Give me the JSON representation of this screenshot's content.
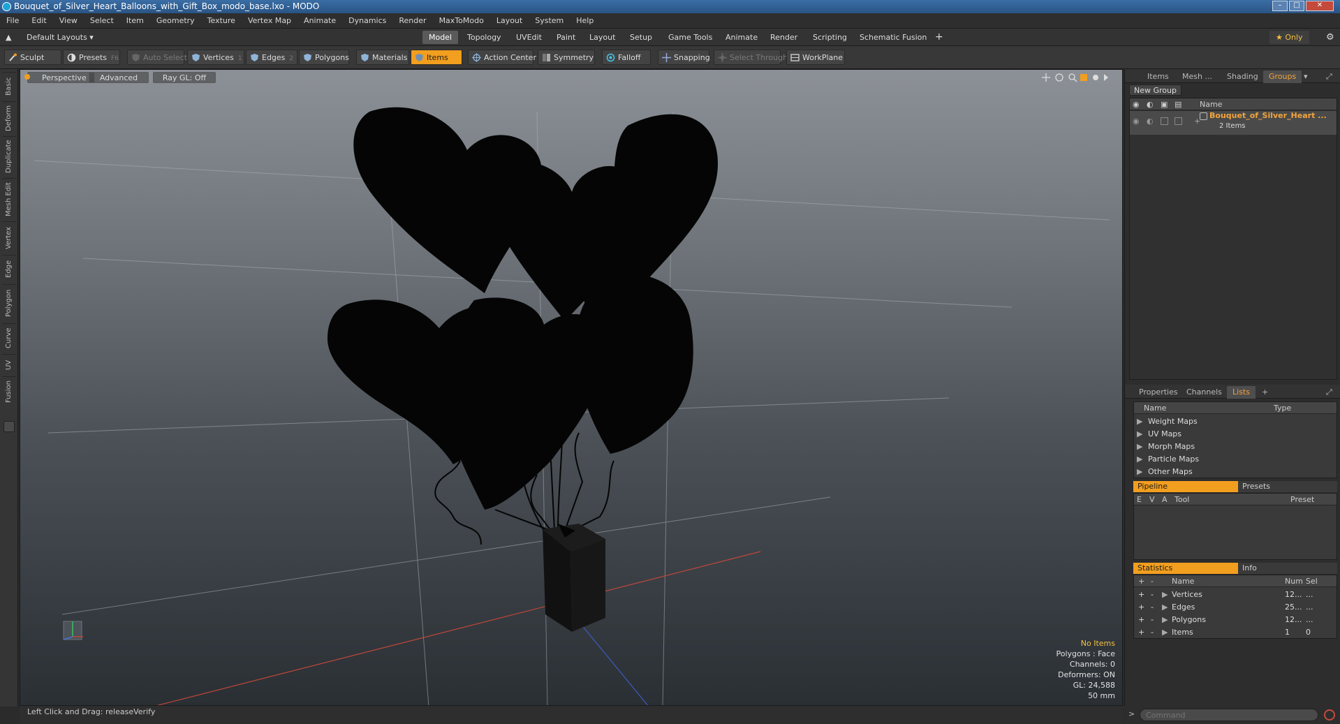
{
  "window": {
    "title": "Bouquet_of_Silver_Heart_Balloons_with_Gift_Box_modo_base.lxo - MODO"
  },
  "menu": [
    "File",
    "Edit",
    "View",
    "Select",
    "Item",
    "Geometry",
    "Texture",
    "Vertex Map",
    "Animate",
    "Dynamics",
    "Render",
    "MaxToModo",
    "Layout",
    "System",
    "Help"
  ],
  "layout": {
    "preset": "Default Layouts ▾",
    "tabs": [
      "Model",
      "Topology",
      "UVEdit",
      "Paint",
      "Layout",
      "Setup",
      "Game Tools",
      "Animate",
      "Render",
      "Scripting",
      "Schematic Fusion"
    ],
    "active_tab": "Model",
    "add": "+",
    "only": "★  Only",
    "settings": "⚙"
  },
  "toolbar": {
    "sculpt": "Sculpt",
    "presets": "Presets",
    "presets_key": "F6",
    "auto_select": "Auto Select",
    "vertices": "Vertices",
    "vertices_count": "1",
    "edges": "Edges",
    "edges_count": "2",
    "polygons": "Polygons",
    "materials": "Materials",
    "items": "Items",
    "action_center": "Action Center",
    "symmetry": "Symmetry",
    "falloff": "Falloff",
    "snapping": "Snapping",
    "select_through": "Select Through",
    "workplane": "WorkPlane"
  },
  "left_tabs": [
    "Basic",
    "Deform",
    "Duplicate",
    "Mesh Edit",
    "Vertex",
    "Edge",
    "Polygon",
    "Curve",
    "UV",
    "Fusion"
  ],
  "viewport": {
    "perspective": "Perspective",
    "advanced": "Advanced",
    "raygl": "Ray GL: Off",
    "info": {
      "no_items": "No Items",
      "polygons": "Polygons : Face",
      "channels": "Channels: 0",
      "deformers": "Deformers: ON",
      "gl": "GL: 24,588",
      "focal": "50 mm"
    }
  },
  "status": {
    "text": "Left Click and Drag:  releaseVerify"
  },
  "groups_panel": {
    "tabs": [
      "Items",
      "Mesh ...",
      "Shading",
      "Groups"
    ],
    "active_tab": "Groups",
    "new_group": "New Group",
    "col_name": "Name",
    "group_name": "Bouquet_of_Silver_Heart ...",
    "group_count": "2 Items"
  },
  "lists_panel": {
    "tabs": [
      "Properties",
      "Channels",
      "Lists"
    ],
    "active_tab": "Lists",
    "add": "+",
    "col_name": "Name",
    "col_type": "Type",
    "rows": [
      "Weight Maps",
      "UV Maps",
      "Morph Maps",
      "Particle Maps",
      "Other Maps"
    ]
  },
  "pipeline_panel": {
    "tab_pipeline": "Pipeline",
    "tab_presets": "Presets",
    "col_e": "E",
    "col_v": "V",
    "col_a": "A",
    "col_tool": "Tool",
    "col_preset": "Preset"
  },
  "stats_panel": {
    "tab_statistics": "Statistics",
    "tab_info": "Info",
    "col_plus": "+",
    "col_minus": "-",
    "col_name": "Name",
    "col_num": "Num",
    "col_sel": "Sel",
    "rows": [
      {
        "name": "Vertices",
        "num": "12...",
        "sel": "..."
      },
      {
        "name": "Edges",
        "num": "25...",
        "sel": "..."
      },
      {
        "name": "Polygons",
        "num": "12...",
        "sel": "..."
      },
      {
        "name": "Items",
        "num": "1",
        "sel": "0"
      }
    ]
  },
  "command": {
    "placeholder": "Command",
    "prompt": ">"
  },
  "colors": {
    "accent": "#f29e1f",
    "group_name": "#f3a43a",
    "title_bar": "#2f5b8e"
  }
}
